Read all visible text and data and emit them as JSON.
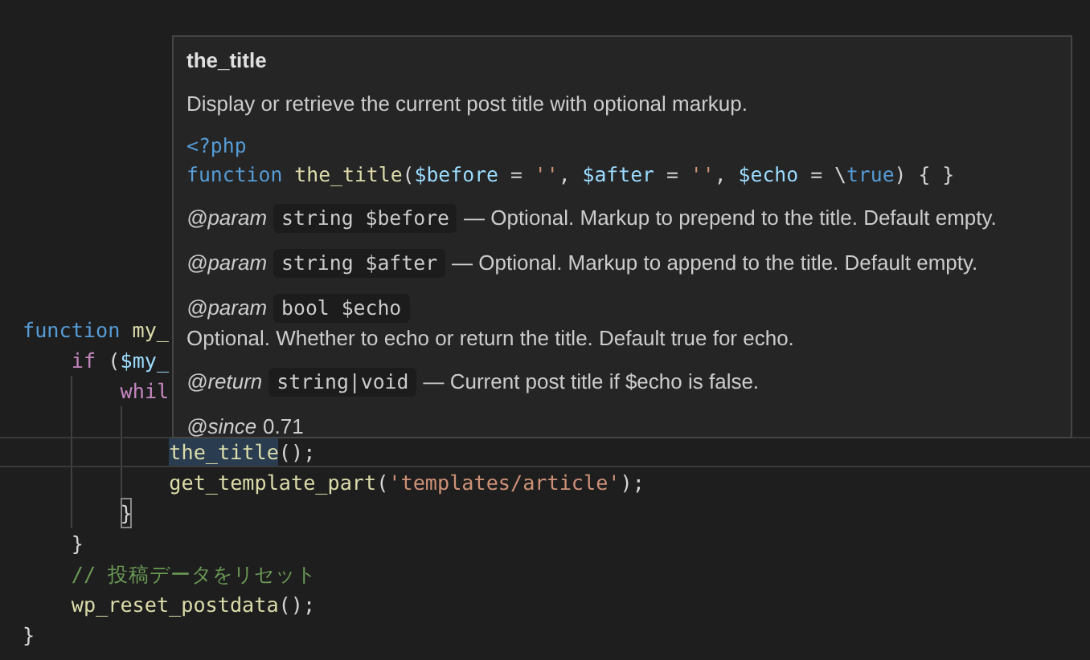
{
  "editor": {
    "lines": [
      {
        "current": false,
        "tokens": [
          {
            "t": "function",
            "kind": "keyword"
          },
          {
            "t": " my_",
            "kind": "fn"
          }
        ]
      },
      {
        "current": false,
        "tokens": [
          {
            "t": "    if",
            "kind": "control"
          },
          {
            "t": " (",
            "kind": "plain"
          },
          {
            "t": "$my_",
            "kind": "var"
          }
        ]
      },
      {
        "current": false,
        "tokens": [
          {
            "t": "        whil",
            "kind": "control"
          }
        ]
      },
      {
        "current": false
      },
      {
        "current": true,
        "tokens": [
          {
            "t": "            the_title",
            "kind": "fn",
            "highlighted": true
          },
          {
            "t": "();",
            "kind": "plain"
          }
        ]
      },
      {
        "current": false,
        "tokens": [
          {
            "t": "            get_template_part",
            "kind": "fn"
          },
          {
            "t": "(",
            "kind": "plain"
          },
          {
            "t": "'templates/article'",
            "kind": "string"
          },
          {
            "t": ");",
            "kind": "plain"
          }
        ]
      },
      {
        "current": false,
        "tokens": [
          {
            "t": "        }",
            "kind": "plain",
            "bracket_match": true
          }
        ]
      },
      {
        "current": false,
        "tokens": [
          {
            "t": "    }",
            "kind": "plain"
          }
        ]
      },
      {
        "current": false,
        "tokens": [
          {
            "t": "    // 投稿データをリセット",
            "kind": "comment"
          }
        ]
      },
      {
        "current": false,
        "tokens": [
          {
            "t": "    wp_reset_postdata",
            "kind": "fn"
          },
          {
            "t": "();",
            "kind": "plain"
          }
        ]
      },
      {
        "current": false,
        "tokens": [
          {
            "t": "}",
            "kind": "plain"
          }
        ]
      }
    ]
  },
  "hover": {
    "title": "the_title",
    "description": "Display or retrieve the current post title with optional markup.",
    "signature": [
      [
        {
          "t": "<?php",
          "kind": "keyword"
        }
      ],
      [
        {
          "t": "function",
          "kind": "keyword"
        },
        {
          "t": " the_title",
          "kind": "fn"
        },
        {
          "t": "(",
          "kind": "plain"
        },
        {
          "t": "$before",
          "kind": "var"
        },
        {
          "t": " =",
          "kind": "plain"
        },
        {
          "t": " ''",
          "kind": "string"
        },
        {
          "t": ",",
          "kind": "plain"
        },
        {
          "t": " $after",
          "kind": "var"
        },
        {
          "t": " =",
          "kind": "plain"
        },
        {
          "t": " ''",
          "kind": "string"
        },
        {
          "t": ",",
          "kind": "plain"
        },
        {
          "t": " $echo",
          "kind": "var"
        },
        {
          "t": " = \\",
          "kind": "plain"
        },
        {
          "t": "true",
          "kind": "keyword"
        },
        {
          "t": ") { }",
          "kind": "plain"
        }
      ]
    ],
    "tags": [
      {
        "kind": "inline",
        "tag": "@param",
        "code": "string $before",
        "text": "— Optional. Markup to prepend to the title. Default empty."
      },
      {
        "kind": "inline",
        "tag": "@param",
        "code": "string $after",
        "text": "— Optional. Markup to append to the title. Default empty."
      },
      {
        "kind": "block",
        "tag": "@param",
        "code": "bool $echo",
        "text": "Optional. Whether to echo or return the title. Default true for echo."
      },
      {
        "kind": "inline",
        "tag": "@return",
        "code": "string|void",
        "text": "— Current post title if $echo is false."
      },
      {
        "kind": "plain",
        "tag": "@since",
        "text": "0.71"
      }
    ]
  }
}
